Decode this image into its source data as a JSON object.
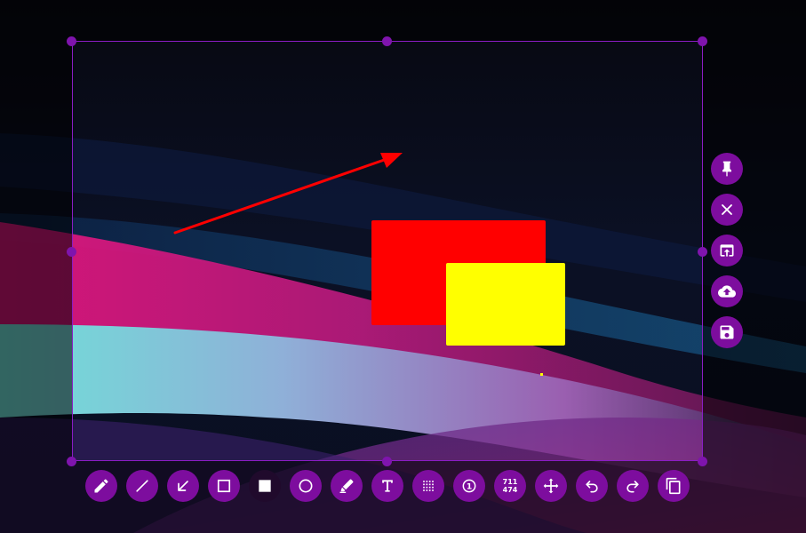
{
  "toolbar": {
    "tools": [
      {
        "name": "pencil-tool",
        "icon": "pencil-icon"
      },
      {
        "name": "line-tool",
        "icon": "line-icon"
      },
      {
        "name": "arrow-tool",
        "icon": "arrow-icon"
      },
      {
        "name": "rectangle-tool",
        "icon": "rectangle-outline-icon"
      },
      {
        "name": "filled-rectangle-tool",
        "icon": "filled-rectangle-icon",
        "active": true
      },
      {
        "name": "circle-tool",
        "icon": "circle-icon"
      },
      {
        "name": "marker-tool",
        "icon": "marker-icon"
      },
      {
        "name": "text-tool",
        "icon": "text-icon"
      },
      {
        "name": "pixelate-tool",
        "icon": "pixelate-icon"
      },
      {
        "name": "counter-tool",
        "icon": "counter-icon",
        "label": "1"
      },
      {
        "name": "selection-size-tool",
        "icon": "size-readout"
      },
      {
        "name": "move-selection-tool",
        "icon": "move-icon"
      },
      {
        "name": "undo-tool",
        "icon": "undo-icon"
      },
      {
        "name": "redo-tool",
        "icon": "redo-icon"
      },
      {
        "name": "copy-tool",
        "icon": "copy-icon"
      }
    ],
    "size_readout": {
      "width": "711",
      "height": "474"
    }
  },
  "side_actions": [
    {
      "name": "pin-button",
      "icon": "pin-icon"
    },
    {
      "name": "exit-button",
      "icon": "close-icon"
    },
    {
      "name": "open-app-button",
      "icon": "open-in-app-icon"
    },
    {
      "name": "upload-button",
      "icon": "cloud-upload-icon"
    },
    {
      "name": "save-button",
      "icon": "save-icon"
    }
  ],
  "colors": {
    "accent": "#7d0d9e",
    "selection_border": "#8a1cc4",
    "arrow": "#ff0000",
    "rect_red": "#ff0000",
    "rect_yellow": "#ffff00"
  }
}
